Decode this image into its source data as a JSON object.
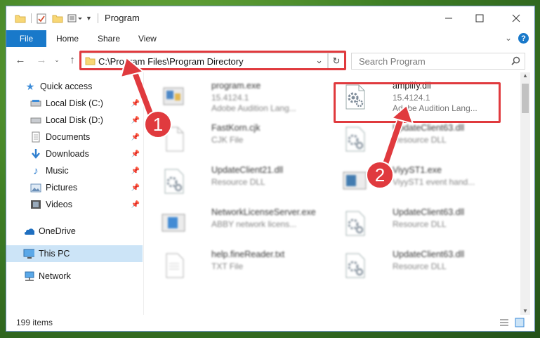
{
  "window": {
    "title": "Program"
  },
  "ribbon": {
    "file": "File",
    "home": "Home",
    "share": "Share",
    "view": "View"
  },
  "address": {
    "path": "C:\\Program Files\\Program Directory"
  },
  "search": {
    "placeholder": "Search Program"
  },
  "sidebar": {
    "items": [
      {
        "label": "Quick access",
        "icon": "star-icon"
      },
      {
        "label": "Local Disk (C:)",
        "icon": "drive-icon"
      },
      {
        "label": "Local Disk (D:)",
        "icon": "drive-icon"
      },
      {
        "label": "Documents",
        "icon": "documents-icon"
      },
      {
        "label": "Downloads",
        "icon": "download-icon"
      },
      {
        "label": "Music",
        "icon": "music-icon"
      },
      {
        "label": "Pictures",
        "icon": "pictures-icon"
      },
      {
        "label": "Videos",
        "icon": "videos-icon"
      },
      {
        "label": "OneDrive",
        "icon": "cloud-icon"
      },
      {
        "label": "This PC",
        "icon": "computer-icon"
      },
      {
        "label": "Network",
        "icon": "network-icon"
      }
    ]
  },
  "files": [
    {
      "name": "program.exe",
      "line1": "15.4124.1",
      "line2": "Adobe Audition Lang...",
      "icon": "exe-icon"
    },
    {
      "name": "amplify.dll",
      "line1": "15.4124.1",
      "line2": "Adobe Audition Lang...",
      "icon": "dll-gear-icon"
    },
    {
      "name": "FastKorn.cjk",
      "line1": "CJK File",
      "line2": "",
      "icon": "blank-file-icon"
    },
    {
      "name": "UpdateClient63.dll",
      "line1": "Resource DLL",
      "line2": "",
      "icon": "dll-gear-icon"
    },
    {
      "name": "UpdateClient21.dll",
      "line1": "Resource DLL",
      "line2": "",
      "icon": "dll-gear-icon"
    },
    {
      "name": "ViyyST1.exe",
      "line1": "ViyyST1 event hand...",
      "line2": "",
      "icon": "exe-icon"
    },
    {
      "name": "NetworkLicenseServer.exe",
      "line1": "ABBY network licens...",
      "line2": "",
      "icon": "exe-icon"
    },
    {
      "name": "UpdateClient63.dll",
      "line1": "Resource DLL",
      "line2": "",
      "icon": "dll-gear-icon"
    },
    {
      "name": "help.fineReader.txt",
      "line1": "TXT File",
      "line2": "",
      "icon": "text-file-icon"
    },
    {
      "name": "UpdateClient63.dll",
      "line1": "Resource DLL",
      "line2": "",
      "icon": "dll-gear-icon"
    }
  ],
  "status": {
    "count": "199 items"
  },
  "callouts": {
    "one": "1",
    "two": "2"
  },
  "colors": {
    "accent": "#1979ca",
    "highlight": "#e03a3e",
    "selected": "#cce4f7"
  }
}
